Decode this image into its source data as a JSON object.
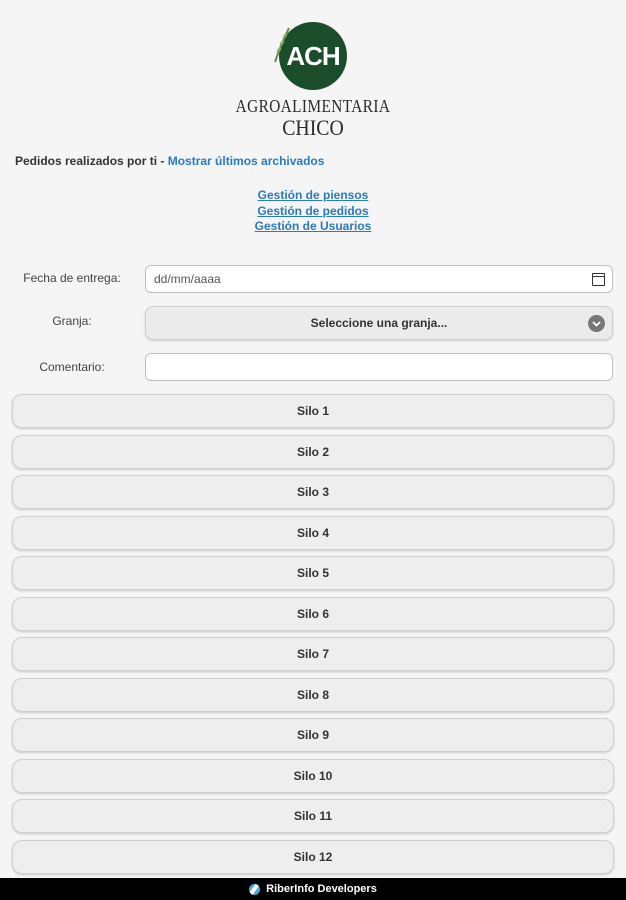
{
  "logo": {
    "initials": "ACH",
    "name_line1": "AGROALIMENTARIA",
    "name_line2": "CHICO",
    "color": "#1b4d2a"
  },
  "orders": {
    "text": "Pedidos realizados por ti",
    "separator": " - ",
    "archive_link": "Mostrar últimos archivados"
  },
  "admin_links": [
    "Gestión de piensos",
    "Gestión de pedidos",
    "Gestión de Usuarios"
  ],
  "form": {
    "date_label": "Fecha de entrega:",
    "date_placeholder": "dd/mm/aaaa",
    "farm_label": "Granja:",
    "farm_selected": "Seleccione una granja...",
    "comment_label": "Comentario:",
    "comment_value": ""
  },
  "silos": [
    "Silo 1",
    "Silo 2",
    "Silo 3",
    "Silo 4",
    "Silo 5",
    "Silo 6",
    "Silo 7",
    "Silo 8",
    "Silo 9",
    "Silo 10",
    "Silo 11",
    "Silo 12"
  ],
  "footer": {
    "text": "RiberInfo Developers"
  },
  "colors": {
    "link": "#2a7abf",
    "background": "#f5f5f5",
    "footer": "#000000"
  }
}
